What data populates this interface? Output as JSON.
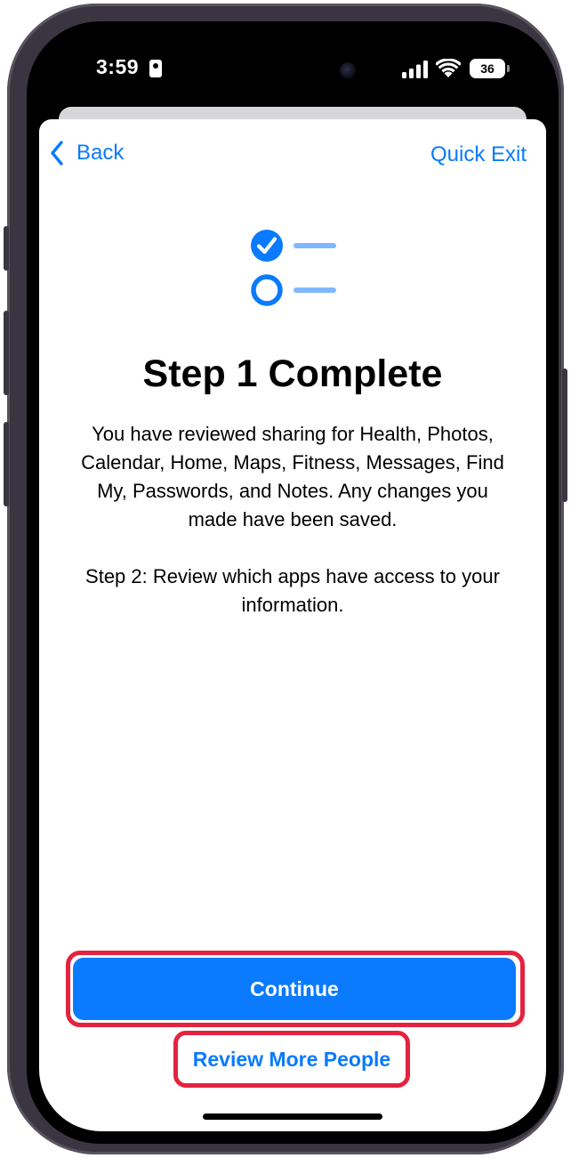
{
  "status_bar": {
    "time": "3:59",
    "battery": "36"
  },
  "nav": {
    "back_label": "Back",
    "quick_exit_label": "Quick Exit"
  },
  "content": {
    "title": "Step 1 Complete",
    "paragraph_1": "You have reviewed sharing for Health, Photos, Calendar, Home, Maps, Fitness, Messages, Find My, Passwords, and Notes. Any changes you made have been saved.",
    "paragraph_2": "Step 2: Review which apps have access to your information."
  },
  "actions": {
    "continue_label": "Continue",
    "review_more_label": "Review More People"
  },
  "icons": {
    "hero": "checklist-icon",
    "back": "chevron-left-icon"
  },
  "colors": {
    "accent": "#0a7aff",
    "accent_light": "#7fb8ff",
    "highlight": "#e3233f"
  }
}
